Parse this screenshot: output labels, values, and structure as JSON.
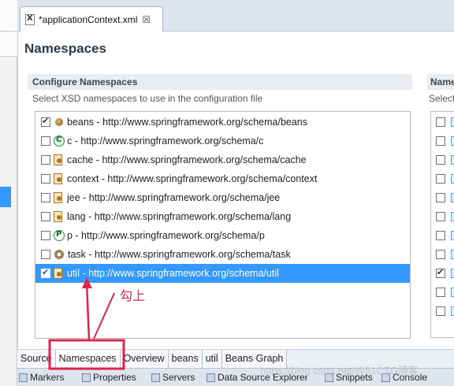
{
  "editor_tab": {
    "title": "*applicationContext.xml",
    "close_glyph": "☒"
  },
  "page": {
    "title": "Namespaces"
  },
  "configure": {
    "heading": "Configure Namespaces",
    "description": "Select XSD namespaces to use in the configuration file",
    "items": [
      {
        "label": "beans - http://www.springframework.org/schema/beans",
        "checked": true,
        "icon": "bean-icon"
      },
      {
        "label": "c - http://www.springframework.org/schema/c",
        "checked": false,
        "icon": "c-namespace-icon"
      },
      {
        "label": "cache - http://www.springframework.org/schema/cache",
        "checked": false,
        "icon": "cache-icon"
      },
      {
        "label": "context - http://www.springframework.org/schema/context",
        "checked": false,
        "icon": "context-icon"
      },
      {
        "label": "jee - http://www.springframework.org/schema/jee",
        "checked": false,
        "icon": "jee-icon"
      },
      {
        "label": "lang - http://www.springframework.org/schema/lang",
        "checked": false,
        "icon": "lang-icon"
      },
      {
        "label": "p - http://www.springframework.org/schema/p",
        "checked": false,
        "icon": "p-namespace-icon"
      },
      {
        "label": "task - http://www.springframework.org/schema/task",
        "checked": false,
        "icon": "task-icon"
      },
      {
        "label": "util - http://www.springframework.org/schema/util",
        "checked": true,
        "selected": true,
        "icon": "util-icon"
      }
    ]
  },
  "right_section": {
    "heading": "Name",
    "description": "Select",
    "checked_rows": [
      false,
      false,
      false,
      false,
      false,
      false,
      false,
      false,
      true,
      false,
      false
    ]
  },
  "annotation": {
    "text": "勾上",
    "color": "#e0234a"
  },
  "bottom_tabs": [
    "Source",
    "Namespaces",
    "Overview",
    "beans",
    "util",
    "Beans Graph"
  ],
  "active_bottom_tab": "Namespaces",
  "views": [
    "Markers",
    "Properties",
    "Servers",
    "Data Source Explorer",
    "Snippets",
    "Console"
  ],
  "watermark": "https://blog.csdn.net/@51CTO博客",
  "colors": {
    "selection": "#3399ff",
    "annotation": "#e0234a"
  }
}
